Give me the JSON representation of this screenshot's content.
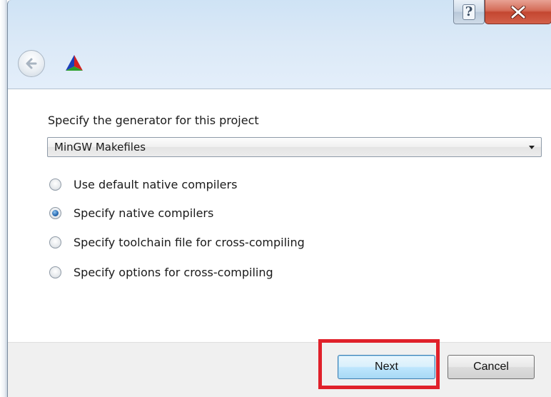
{
  "title_bar": {
    "help_glyph": "?",
    "close_glyph": "X"
  },
  "nav": {
    "back_icon": "back-arrow-icon",
    "app_icon": "cmake-logo-icon"
  },
  "main": {
    "prompt": "Specify the generator for this project",
    "generator": {
      "selected": "MinGW Makefiles"
    },
    "options": [
      {
        "label": "Use default native compilers",
        "checked": false
      },
      {
        "label": "Specify native compilers",
        "checked": true
      },
      {
        "label": "Specify toolchain file for cross-compiling",
        "checked": false
      },
      {
        "label": "Specify options for cross-compiling",
        "checked": false
      }
    ]
  },
  "footer": {
    "next_label": "Next",
    "cancel_label": "Cancel"
  },
  "colors": {
    "highlight": "#e0202a",
    "close_button": "#c44630",
    "selected_radio": "#2d6fb6"
  }
}
